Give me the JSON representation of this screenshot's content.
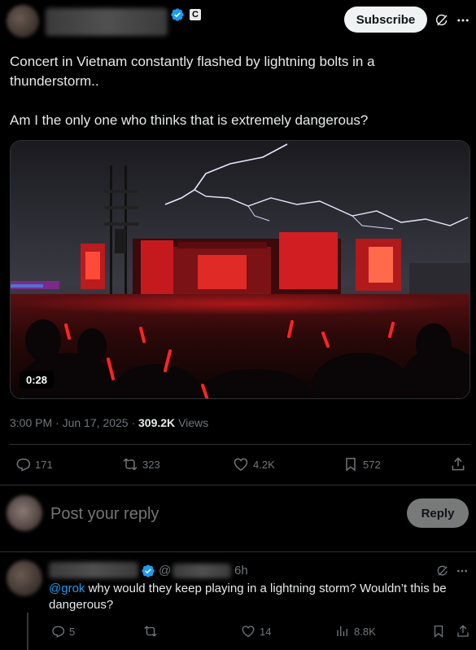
{
  "post": {
    "subscribe_label": "Subscribe",
    "badge_letter": "C",
    "text_line1": "Concert in Vietnam constantly flashed by lightning bolts in a thunderstorm..",
    "text_line2": "Am I the only one who thinks that is extremely dangerous?",
    "video_duration": "0:28",
    "time": "3:00 PM",
    "date": "Jun 17, 2025",
    "views_count": "309.2K",
    "views_label": "Views",
    "stats": {
      "replies": "171",
      "reposts": "323",
      "likes": "4.2K",
      "bookmarks": "572"
    }
  },
  "reply_box": {
    "placeholder": "Post your reply",
    "button_label": "Reply"
  },
  "reply": {
    "handle_prefix": "@",
    "time": "6h",
    "mention": "@grok",
    "text": " why would they keep playing in a lightning storm? Wouldn’t this be dangerous?",
    "stats": {
      "replies": "5",
      "likes": "14",
      "views": "8.8K"
    }
  },
  "colors": {
    "background": "#000000",
    "text": "#e7e9ea",
    "muted": "#71767b",
    "accent": "#1d9bf0",
    "divider": "#2f3336"
  },
  "icons": [
    "verified-badge-icon",
    "grok-icon",
    "more-icon",
    "reply-icon",
    "repost-icon",
    "like-icon",
    "bookmark-icon",
    "share-icon",
    "views-icon"
  ]
}
